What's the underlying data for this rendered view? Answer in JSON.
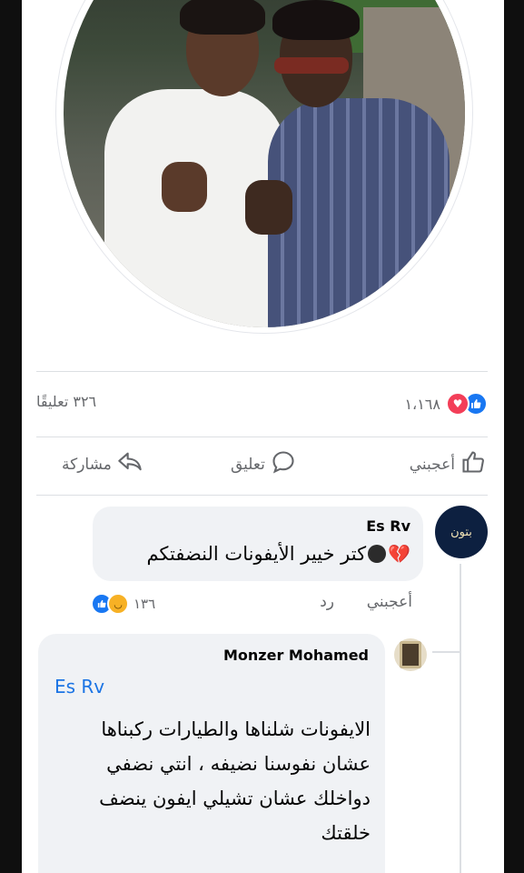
{
  "post": {
    "reactions_count": "١،١٦٨",
    "comments_count": "٣٢٦ تعليقًا",
    "reaction_icons": [
      "like-icon",
      "love-icon"
    ]
  },
  "actions": {
    "like": "أعجبني",
    "comment": "تعليق",
    "share": "مشاركة"
  },
  "comment1": {
    "author": "Es Rv",
    "avatar_text": "بتون",
    "text": "كتر خيير الأيفونات النضفتكم",
    "emojis": [
      "black-ball-emoji",
      "broken-heart-emoji"
    ],
    "like_label": "أعجبني",
    "reply_label": "رد",
    "reaction_count": "١٣٦"
  },
  "reply1": {
    "author": "Monzer Mohamed",
    "mention": "Es Rv",
    "text": "الايفونات شلناها والطيارات ركبناها عشان نفوسنا نضيفه ، انتي نضفي دواخلك عشان تشيلي ايفون ينضف خلقتك"
  },
  "colors": {
    "accent": "#1877f2",
    "love": "#f33e58",
    "bubble": "#f0f2f5",
    "muted_text": "#65676b"
  }
}
